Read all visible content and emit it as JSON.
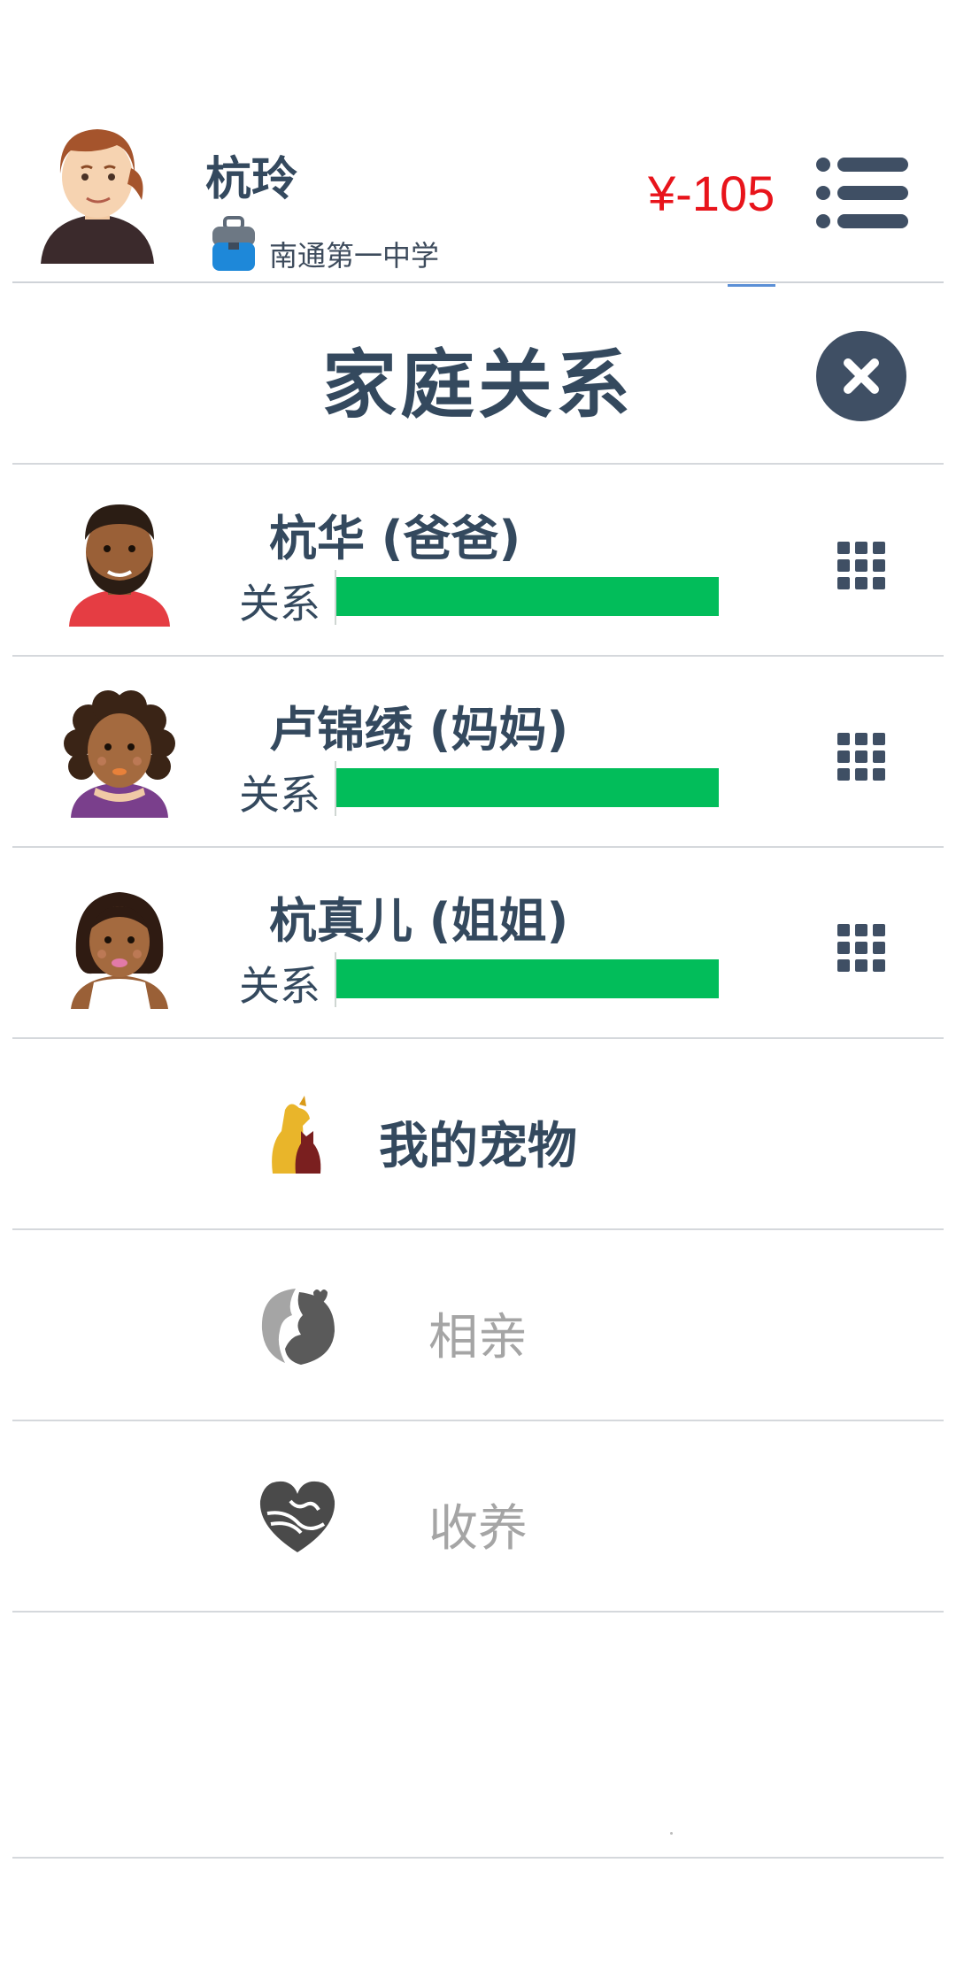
{
  "header": {
    "player_name": "杭玲",
    "school": "南通第一中学",
    "money": "¥-105",
    "avatar_icon": "player-avatar-icon",
    "school_icon": "school-bag-icon",
    "menu_icon": "list-menu-icon"
  },
  "panel": {
    "title": "家庭关系",
    "close_icon": "close-icon"
  },
  "family": [
    {
      "name": "杭华 (爸爸)",
      "relation_label": "关系",
      "relation_level": 1.0,
      "avatar": "father-avatar-icon"
    },
    {
      "name": "卢锦绣 (妈妈)",
      "relation_label": "关系",
      "relation_level": 1.0,
      "avatar": "mother-avatar-icon"
    },
    {
      "name": "杭真儿 (姐姐)",
      "relation_label": "关系",
      "relation_level": 1.0,
      "avatar": "sister-avatar-icon"
    }
  ],
  "actions": [
    {
      "label": "我的宠物",
      "icon": "pets-icon",
      "enabled": true
    },
    {
      "label": "相亲",
      "icon": "matchmaking-icon",
      "enabled": false
    },
    {
      "label": "收养",
      "icon": "adoption-heart-icon",
      "enabled": false
    }
  ],
  "colors": {
    "primary_text": "#34495e",
    "money": "#e8141b",
    "relation_bar": "#02bd5a",
    "disabled_text": "#a5a5a5",
    "close_button": "#3f4f64"
  }
}
